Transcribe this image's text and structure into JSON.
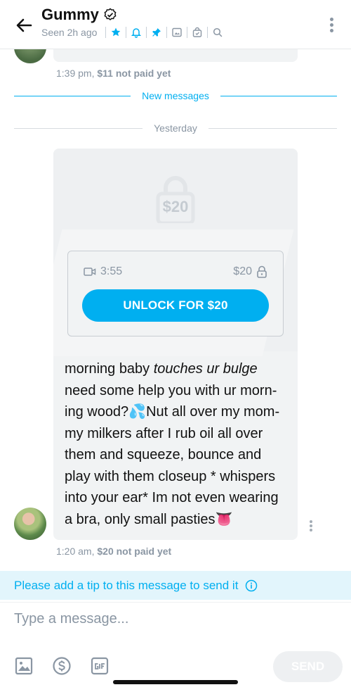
{
  "header": {
    "name": "Gummy",
    "seen": "Seen 2h ago"
  },
  "previous_message": {
    "time": "1:39 pm,",
    "price_status": "$11 not paid yet"
  },
  "dividers": {
    "new_messages": "New messages",
    "yesterday": "Yesterday"
  },
  "message": {
    "lock_price": "$20",
    "video_duration": "3:55",
    "price": "$20",
    "unlock_label": "UNLOCK FOR $20",
    "text_part1": "morning baby ",
    "text_italic": "touches ur bulge",
    "text_part2": " need some help you with ur morn-ing wood?💦Nut all over my mom-my milkers after I rub oil all over them and squeeze, bounce and play with them closeup * whispers into your ear* Im not even wearing a bra, only small pasties👅",
    "time": "1:20 am,",
    "price_status": "$20 not paid yet"
  },
  "tip_bar": {
    "text": "Please add a tip to this message to send it"
  },
  "composer": {
    "placeholder": "Type a message...",
    "send_label": "SEND"
  },
  "colors": {
    "accent": "#00aff0",
    "muted": "#8a96a3",
    "bubble": "#f1f3f4"
  },
  "icons": [
    "back-arrow-icon",
    "verified-icon",
    "star-icon",
    "bell-icon",
    "pin-icon",
    "image-icon",
    "bag-icon",
    "search-icon",
    "video-icon",
    "lock-icon",
    "info-icon",
    "dollar-icon",
    "gif-icon"
  ]
}
